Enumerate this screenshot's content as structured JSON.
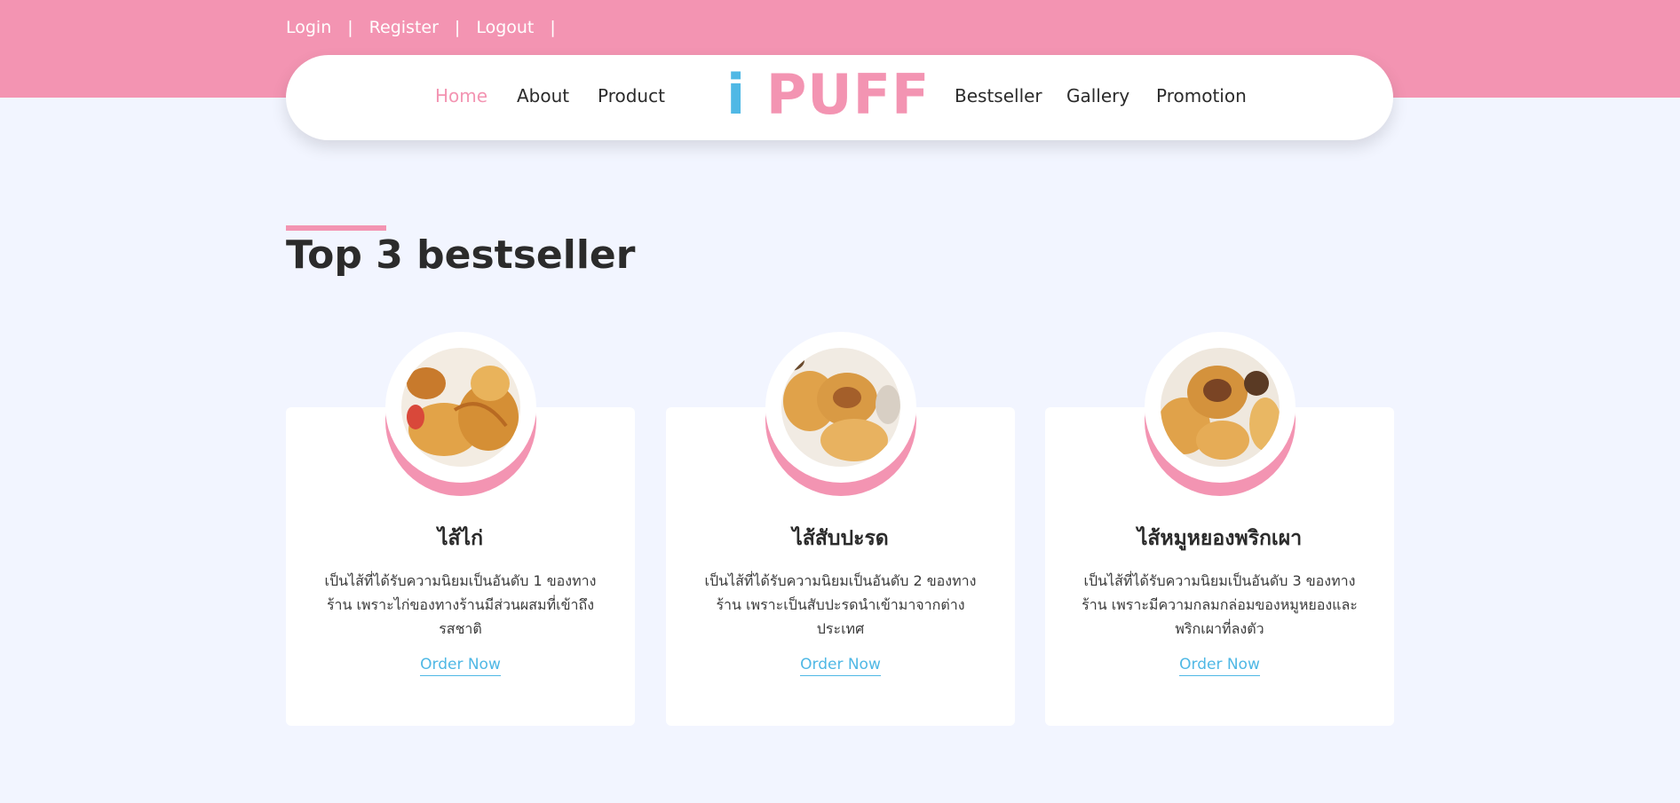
{
  "auth": {
    "login": "Login",
    "register": "Register",
    "logout": "Logout",
    "separator": "|"
  },
  "nav": {
    "home": "Home",
    "about": "About",
    "product": "Product",
    "bestseller": "Bestseller",
    "gallery": "Gallery",
    "promotion": "Promotion",
    "logo_i": "i",
    "logo_rest": "PUFF"
  },
  "colors": {
    "brand_pink": "#f394b2",
    "brand_blue": "#4fb8e5",
    "background": "#f2f5ff"
  },
  "section": {
    "title": "Top 3 bestseller"
  },
  "cards": [
    {
      "name": "ไส้ไก่",
      "desc": "เป็นไส้ที่ได้รับความนิยมเป็นอันดับ 1 ของทางร้าน เพราะไก่ของทางร้านมีส่วนผสมที่เข้าถึงรสชาติ",
      "order": "Order Now"
    },
    {
      "name": "ไส้สับปะรด",
      "desc": "เป็นไส้ที่ได้รับความนิยมเป็นอันดับ 2 ของทางร้าน เพราะเป็นสับปะรดนำเข้ามาจากต่างประเทศ",
      "order": "Order Now"
    },
    {
      "name": "ไส้หมูหยองพริกเผา",
      "desc": "เป็นไส้ที่ได้รับความนิยมเป็นอันดับ 3 ของทางร้าน เพราะมีความกลมกล่อมของหมูหยองและพริกเผาที่ลงตัว",
      "order": "Order Now"
    }
  ]
}
